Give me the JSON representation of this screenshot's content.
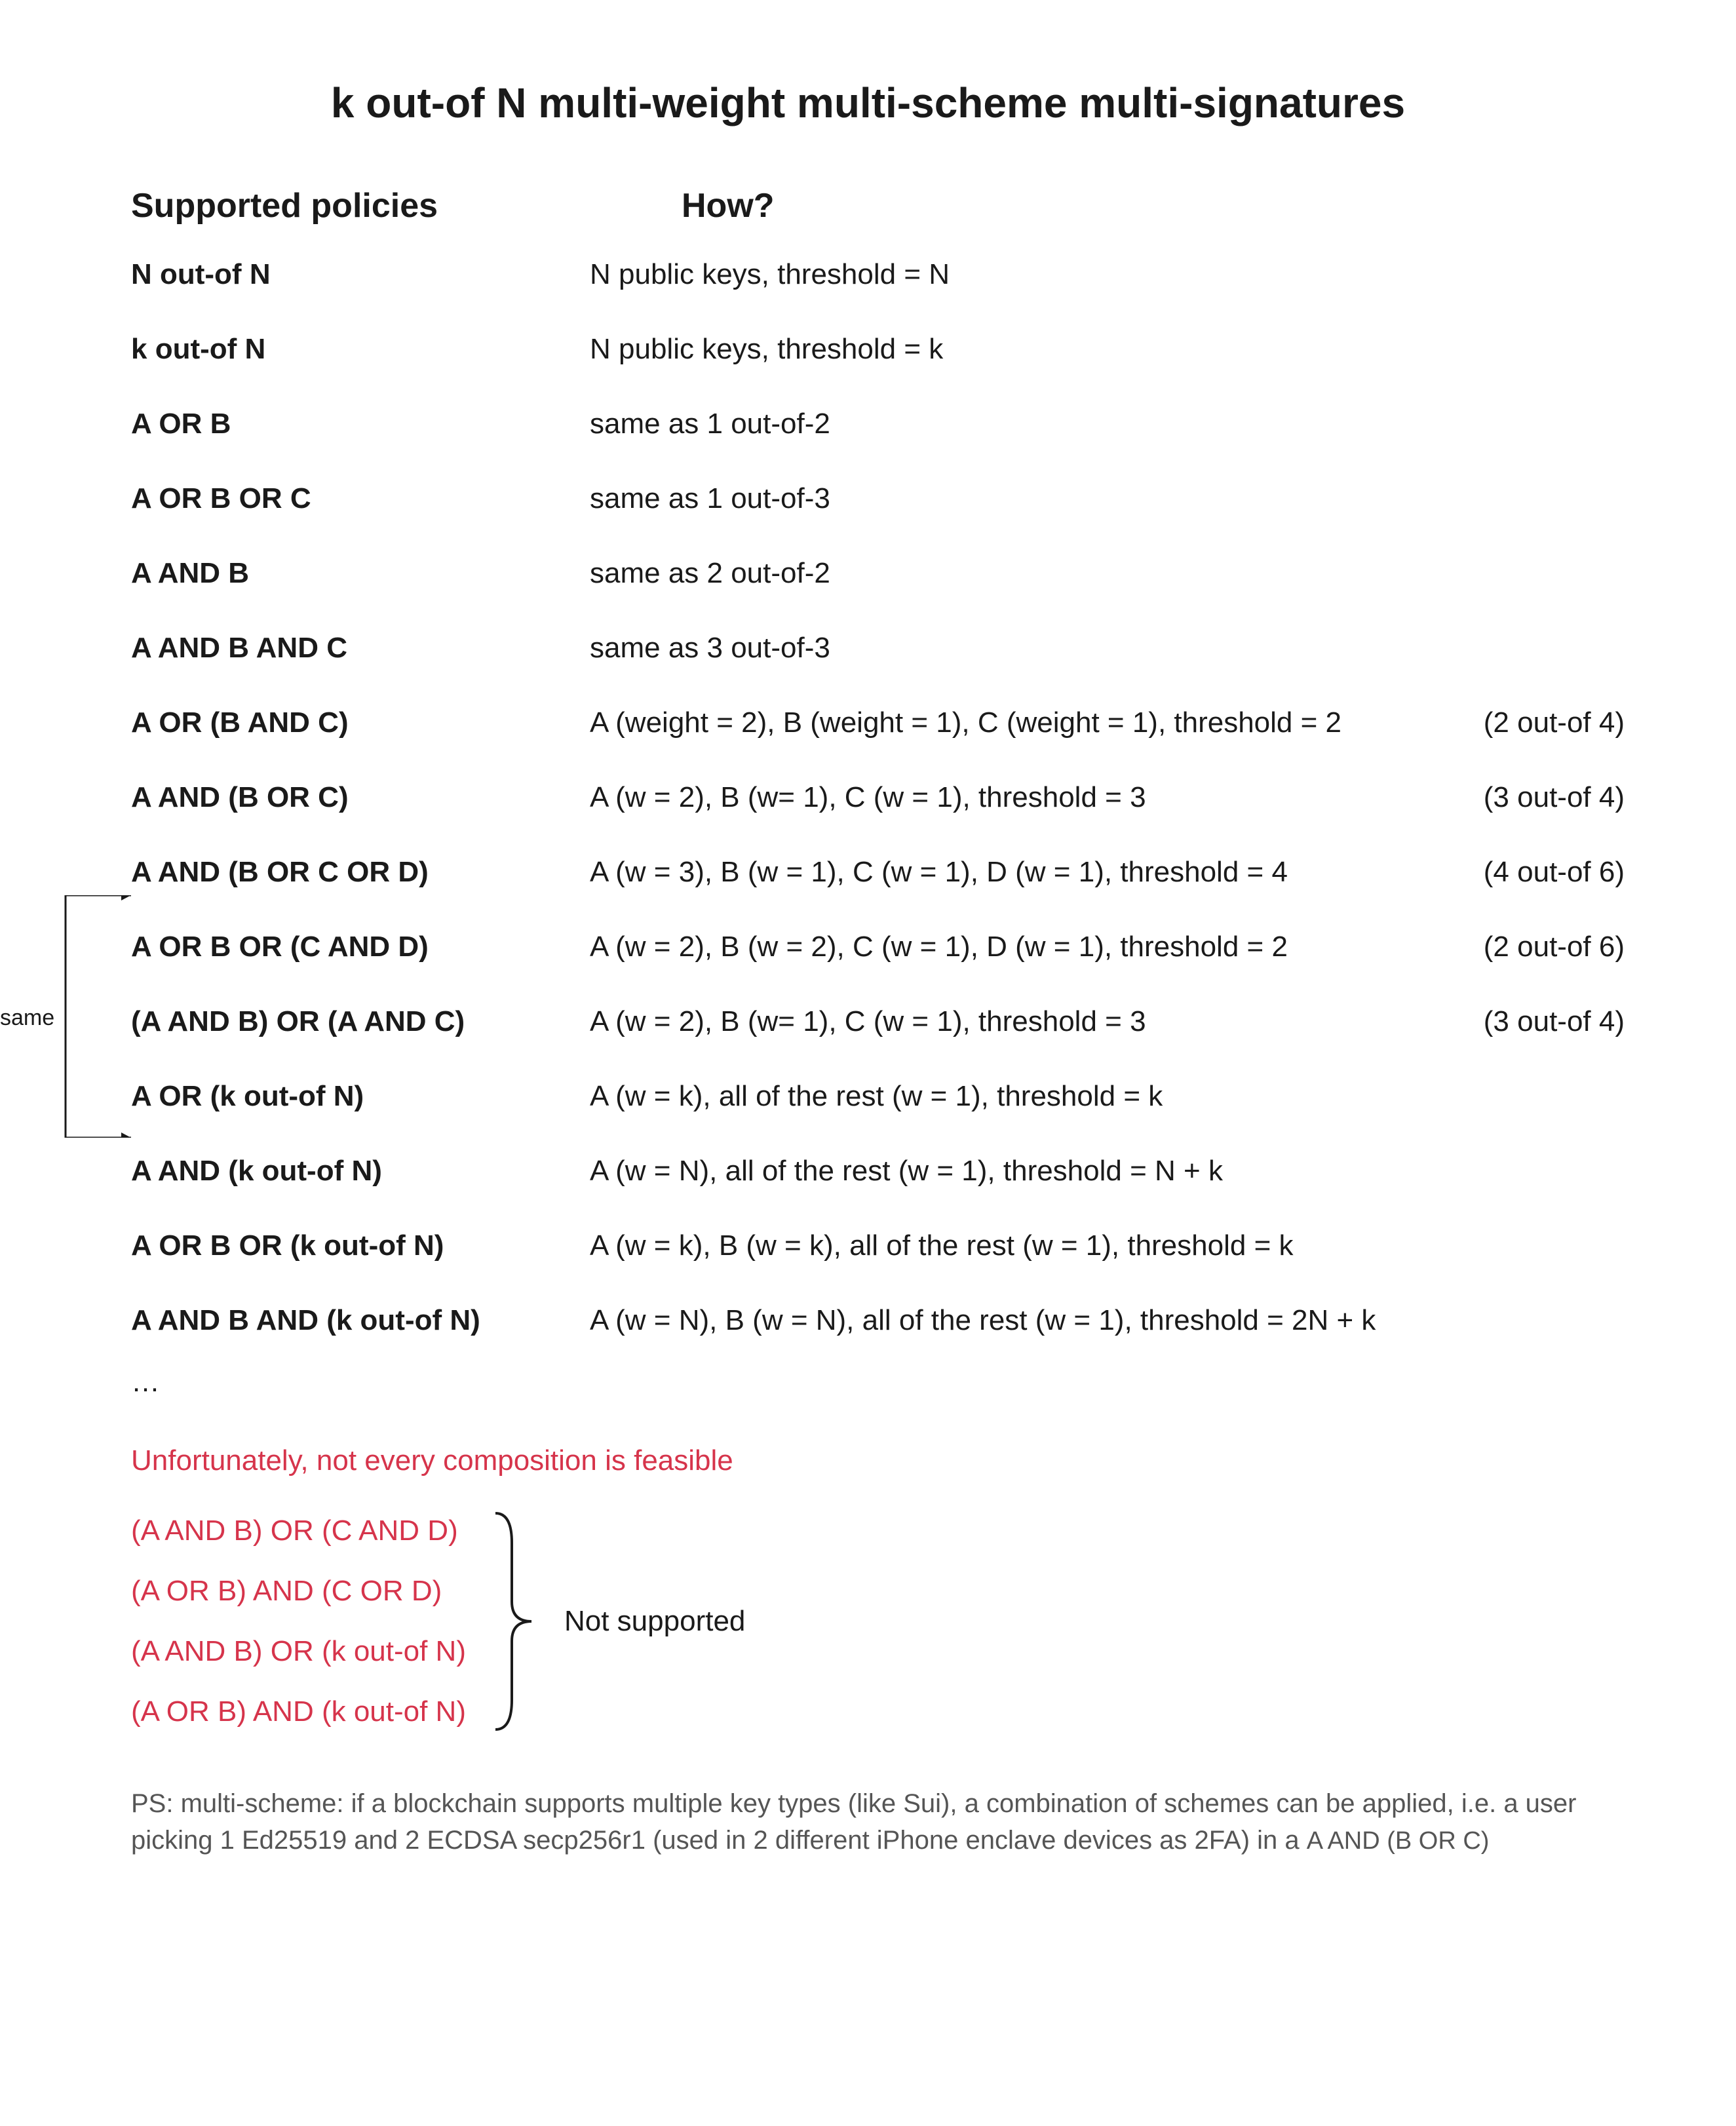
{
  "title": "k out-of N multi-weight multi-scheme multi-signatures",
  "headers": {
    "policies": "Supported policies",
    "how": "How?"
  },
  "rows": [
    {
      "policy": "N out-of N",
      "how": "N public keys, threshold = N",
      "note": ""
    },
    {
      "policy": "k out-of N",
      "how": "N public keys, threshold = k",
      "note": ""
    },
    {
      "policy": "A OR B",
      "how": "same as 1 out-of-2",
      "note": ""
    },
    {
      "policy": "A OR B OR C",
      "how": "same as 1 out-of-3",
      "note": ""
    },
    {
      "policy": "A AND B",
      "how": "same as 2 out-of-2",
      "note": ""
    },
    {
      "policy": "A AND B AND C",
      "how": "same as 3 out-of-3",
      "note": ""
    },
    {
      "policy": "A OR (B AND C)",
      "how": "A (weight = 2), B (weight = 1), C (weight = 1), threshold = 2",
      "note": "(2 out-of 4)"
    },
    {
      "policy": "A AND (B OR C)",
      "how": "A (w = 2), B (w= 1), C (w = 1), threshold = 3",
      "note": "(3 out-of 4)"
    },
    {
      "policy": "A AND (B OR C OR D)",
      "how": "A (w = 3), B (w = 1), C (w = 1), D (w = 1), threshold = 4",
      "note": "(4 out-of 6)"
    },
    {
      "policy": "A OR B OR (C AND D)",
      "how": "A (w = 2), B (w = 2), C (w = 1), D (w = 1), threshold = 2",
      "note": "(2 out-of 6)"
    },
    {
      "policy": "(A AND B) OR (A AND C)",
      "how": "A (w = 2), B (w= 1), C (w = 1), threshold = 3",
      "note": "(3 out-of 4)"
    },
    {
      "policy": "A OR (k out-of N)",
      "how": "A (w = k), all of the rest (w = 1), threshold = k",
      "note": ""
    },
    {
      "policy": "A AND (k out-of N)",
      "how": "A (w = N), all of the rest (w = 1), threshold = N + k",
      "note": ""
    },
    {
      "policy": "A OR B OR (k out-of N)",
      "how": "A (w = k), B (w = k), all of the rest (w = 1), threshold = k",
      "note": ""
    },
    {
      "policy": "A AND B AND (k out-of N)",
      "how": "A (w = N), B (w = N), all of the rest (w = 1), threshold = 2N + k",
      "note": ""
    }
  ],
  "ellipsis": "…",
  "warn": "Unfortunately, not every composition is feasible",
  "unsupported": [
    "(A AND B) OR (C AND D)",
    "(A OR B) AND (C OR D)",
    "(A AND B) OR (k out-of N)",
    "(A OR B) AND (k out-of N)"
  ],
  "unsupported_label": "Not supported",
  "ps_prefix": "PS: multi-scheme: if a blockchain supports multiple key types (like Sui), a combination of schemes can be applied, i.e. a user picking 1 Ed25519 and 2 ECDSA secp256r1 (used in 2 different iPhone enclave devices as 2FA) in a ",
  "ps_code": "A AND (B OR C)",
  "same_label": "same"
}
